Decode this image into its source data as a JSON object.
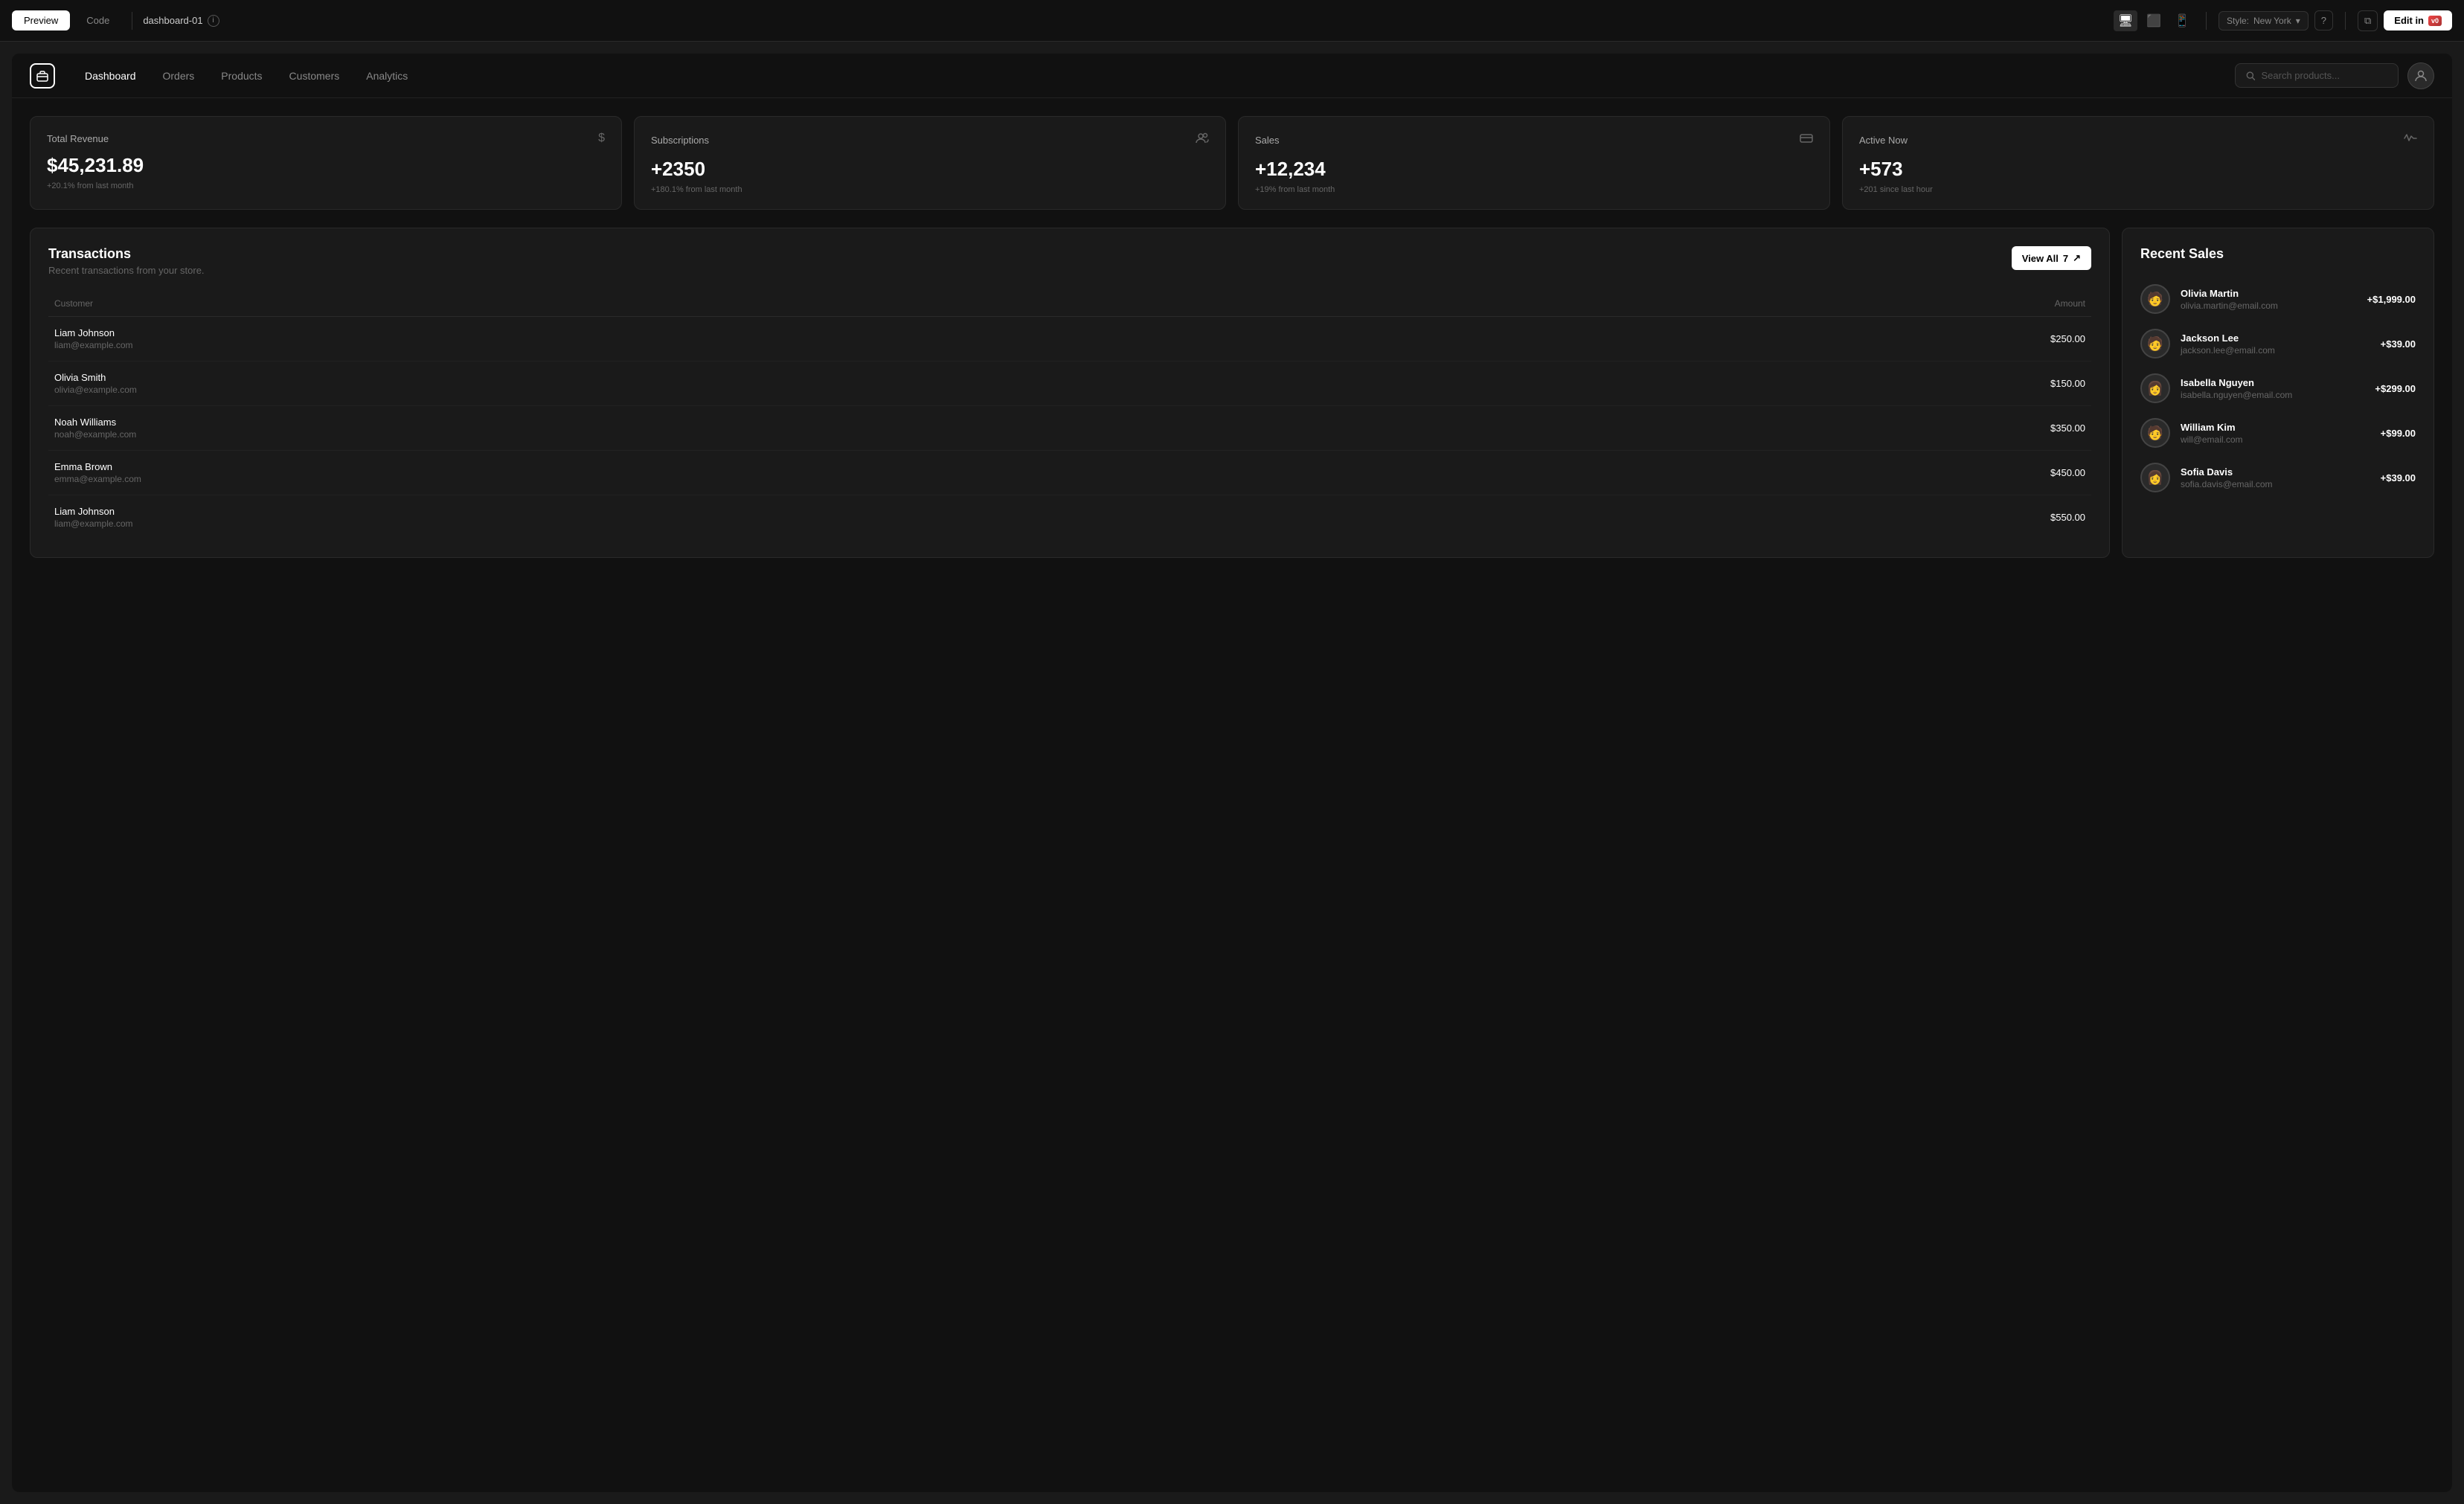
{
  "toolbar": {
    "preview_label": "Preview",
    "code_label": "Code",
    "filename": "dashboard-01",
    "style_prefix": "Style:",
    "style_value": "New York",
    "edit_label": "Edit in"
  },
  "nav": {
    "links": [
      {
        "id": "dashboard",
        "label": "Dashboard",
        "active": true
      },
      {
        "id": "orders",
        "label": "Orders",
        "active": false
      },
      {
        "id": "products",
        "label": "Products",
        "active": false
      },
      {
        "id": "customers",
        "label": "Customers",
        "active": false
      },
      {
        "id": "analytics",
        "label": "Analytics",
        "active": false
      }
    ],
    "search_placeholder": "Search products..."
  },
  "stats": [
    {
      "id": "total-revenue",
      "label": "Total Revenue",
      "icon": "$",
      "value": "$45,231.89",
      "sub": "+20.1% from last month"
    },
    {
      "id": "subscriptions",
      "label": "Subscriptions",
      "icon": "👥",
      "value": "+2350",
      "sub": "+180.1% from last month"
    },
    {
      "id": "sales",
      "label": "Sales",
      "icon": "💳",
      "value": "+12,234",
      "sub": "+19% from last month"
    },
    {
      "id": "active-now",
      "label": "Active Now",
      "icon": "📈",
      "value": "+573",
      "sub": "+201 since last hour"
    }
  ],
  "transactions": {
    "title": "Transactions",
    "subtitle": "Recent transactions from your store.",
    "view_all_label": "View All",
    "view_all_count": "7",
    "columns": {
      "customer": "Customer",
      "amount": "Amount"
    },
    "rows": [
      {
        "name": "Liam Johnson",
        "email": "liam@example.com",
        "amount": "$250.00"
      },
      {
        "name": "Olivia Smith",
        "email": "olivia@example.com",
        "amount": "$150.00"
      },
      {
        "name": "Noah Williams",
        "email": "noah@example.com",
        "amount": "$350.00"
      },
      {
        "name": "Emma Brown",
        "email": "emma@example.com",
        "amount": "$450.00"
      },
      {
        "name": "Liam Johnson",
        "email": "liam@example.com",
        "amount": "$550.00"
      }
    ]
  },
  "recent_sales": {
    "title": "Recent Sales",
    "items": [
      {
        "name": "Olivia Martin",
        "email": "olivia.martin@email.com",
        "amount": "+$1,999.00",
        "avatar": "🧑"
      },
      {
        "name": "Jackson Lee",
        "email": "jackson.lee@email.com",
        "amount": "+$39.00",
        "avatar": "🧑"
      },
      {
        "name": "Isabella Nguyen",
        "email": "isabella.nguyen@email.com",
        "amount": "+$299.00",
        "avatar": "👩"
      },
      {
        "name": "William Kim",
        "email": "will@email.com",
        "amount": "+$99.00",
        "avatar": "🧑"
      },
      {
        "name": "Sofia Davis",
        "email": "sofia.davis@email.com",
        "amount": "+$39.00",
        "avatar": "👩"
      }
    ]
  }
}
